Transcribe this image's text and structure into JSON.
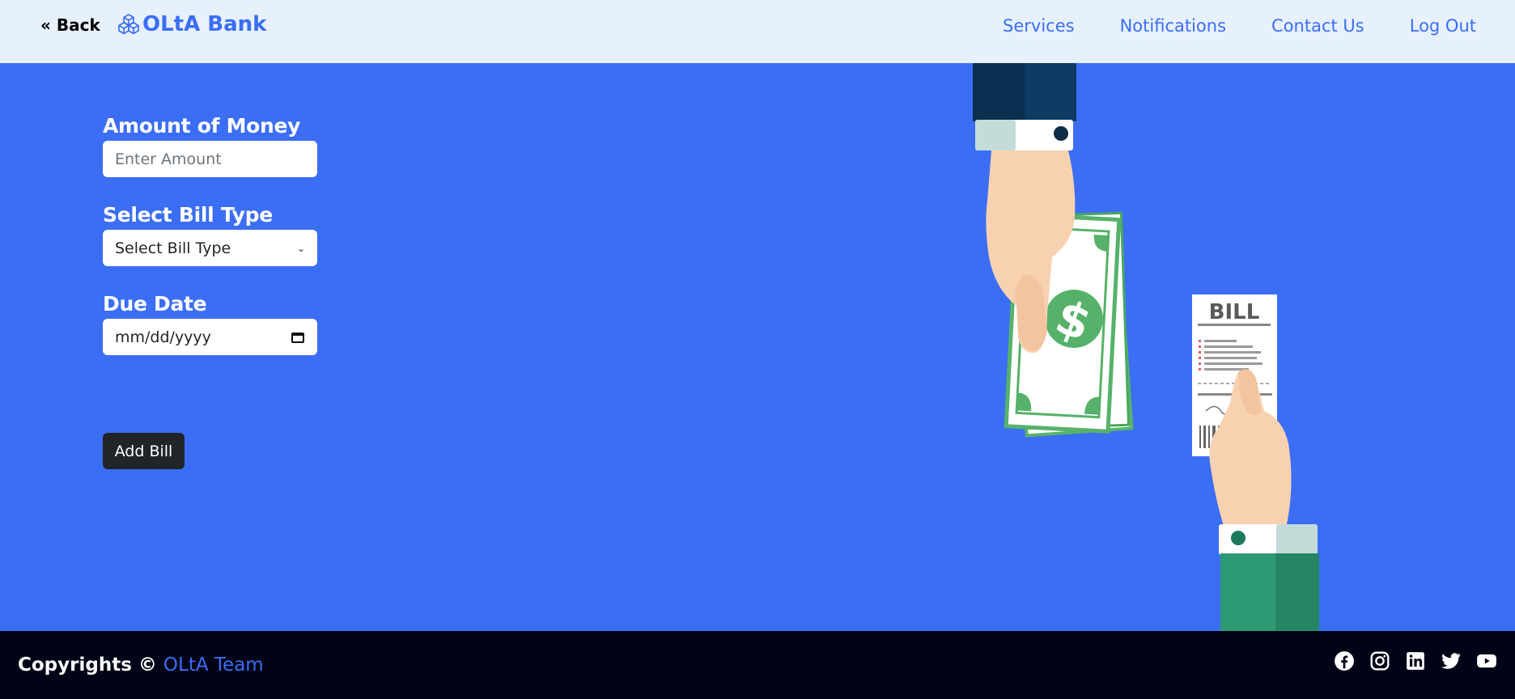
{
  "header": {
    "back_label": "« Back",
    "brand_name": "OLtA Bank",
    "nav": [
      "Services",
      "Notifications",
      "Contact Us",
      "Log Out"
    ]
  },
  "form": {
    "amount": {
      "label": "Amount of Money",
      "placeholder": "Enter Amount"
    },
    "bill_type": {
      "label": "Select Bill Type",
      "selected": "Select Bill Type"
    },
    "due_date": {
      "label": "Due Date",
      "placeholder": "mm/dd/yyyy"
    },
    "submit_label": "Add Bill"
  },
  "illustration": {
    "bill_text": "BILL",
    "currency_symbol": "$"
  },
  "footer": {
    "copyright_prefix": "Copyrights ©",
    "team": "OLtA Team",
    "socials": [
      "facebook-icon",
      "instagram-icon",
      "linkedin-icon",
      "twitter-icon",
      "youtube-icon"
    ]
  },
  "colors": {
    "brand": "#3b6ef5",
    "header_bg": "#e7f1fe",
    "footer_bg": "#010317",
    "button_bg": "#212529"
  }
}
